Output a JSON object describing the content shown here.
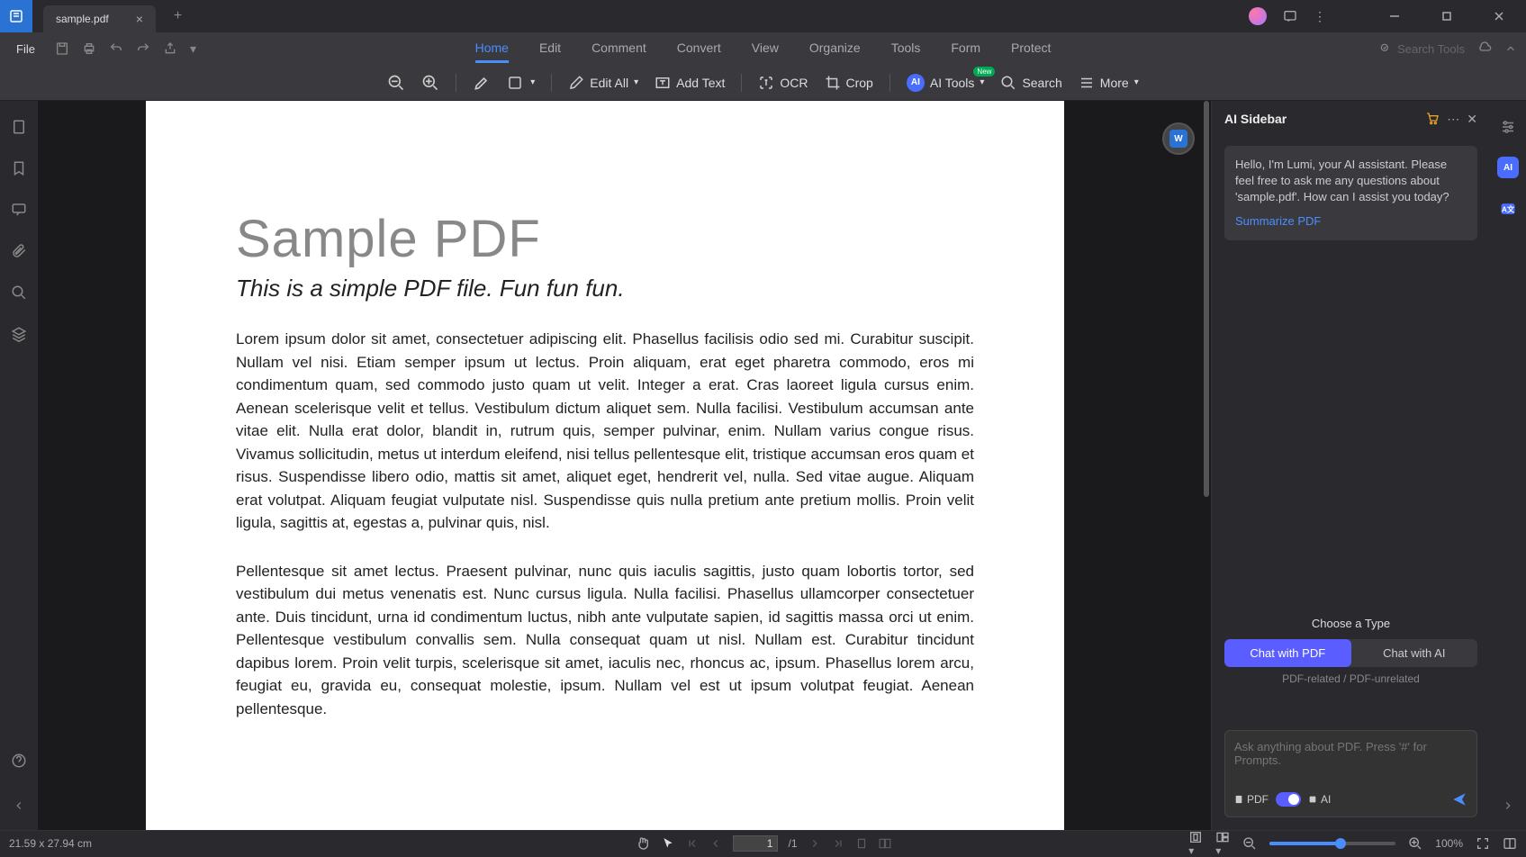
{
  "tab": {
    "title": "sample.pdf"
  },
  "menubar": {
    "file": "File",
    "items": [
      "Home",
      "Edit",
      "Comment",
      "Convert",
      "View",
      "Organize",
      "Tools",
      "Form",
      "Protect"
    ],
    "active": "Home",
    "search_placeholder": "Search Tools"
  },
  "toolbar": {
    "edit_all": "Edit All",
    "add_text": "Add Text",
    "ocr": "OCR",
    "crop": "Crop",
    "ai_tools": "AI Tools",
    "ai_tools_badge": "New",
    "search": "Search",
    "more": "More"
  },
  "document": {
    "title": "Sample PDF",
    "subtitle": "This is a simple PDF file. Fun fun fun.",
    "para1": "Lorem ipsum dolor sit amet, consectetuer adipiscing elit. Phasellus facilisis odio sed mi. Curabitur suscipit. Nullam vel nisi. Etiam semper ipsum ut lectus. Proin aliquam, erat eget pharetra commodo, eros mi condimentum quam, sed commodo justo quam ut velit. Integer a erat. Cras laoreet ligula cursus enim. Aenean scelerisque velit et tellus. Vestibulum dictum aliquet sem. Nulla facilisi. Vestibulum accumsan ante vitae elit. Nulla erat dolor, blandit in, rutrum quis, semper pulvinar, enim. Nullam varius congue risus. Vivamus sollicitudin, metus ut interdum eleifend, nisi tellus pellentesque elit, tristique accumsan eros quam et risus. Suspendisse libero odio, mattis sit amet, aliquet eget, hendrerit vel, nulla. Sed vitae augue. Aliquam erat volutpat. Aliquam feugiat vulputate nisl. Suspendisse quis nulla pretium ante pretium mollis. Proin velit ligula, sagittis at, egestas a, pulvinar quis, nisl.",
    "para2": "Pellentesque sit amet lectus. Praesent pulvinar, nunc quis iaculis sagittis, justo quam lobortis tortor, sed vestibulum dui metus venenatis est. Nunc cursus ligula. Nulla facilisi. Phasellus ullamcorper consectetuer ante. Duis tincidunt, urna id condimentum luctus, nibh ante vulputate sapien, id sagittis massa orci ut enim. Pellentesque vestibulum convallis sem. Nulla consequat quam ut nisl. Nullam est. Curabitur tincidunt dapibus lorem. Proin velit turpis, scelerisque sit amet, iaculis nec, rhoncus ac, ipsum. Phasellus lorem arcu, feugiat eu, gravida eu, consequat molestie, ipsum. Nullam vel est ut ipsum volutpat feugiat. Aenean pellentesque."
  },
  "ai_sidebar": {
    "title": "AI Sidebar",
    "welcome": "Hello, I'm Lumi, your AI assistant. Please feel free to ask me any questions about 'sample.pdf'. How can I assist you today?",
    "summarize_link": "Summarize PDF",
    "choose_label": "Choose a Type",
    "chat_pdf": "Chat with PDF",
    "chat_ai": "Chat with AI",
    "subtext": "PDF-related / PDF-unrelated",
    "input_placeholder": "Ask anything about PDF. Press '#' for Prompts.",
    "mode_pdf": "PDF",
    "mode_ai": "AI"
  },
  "statusbar": {
    "dimensions": "21.59 x 27.94 cm",
    "page_current": "1",
    "page_total": "/1",
    "zoom_label": "100%"
  }
}
